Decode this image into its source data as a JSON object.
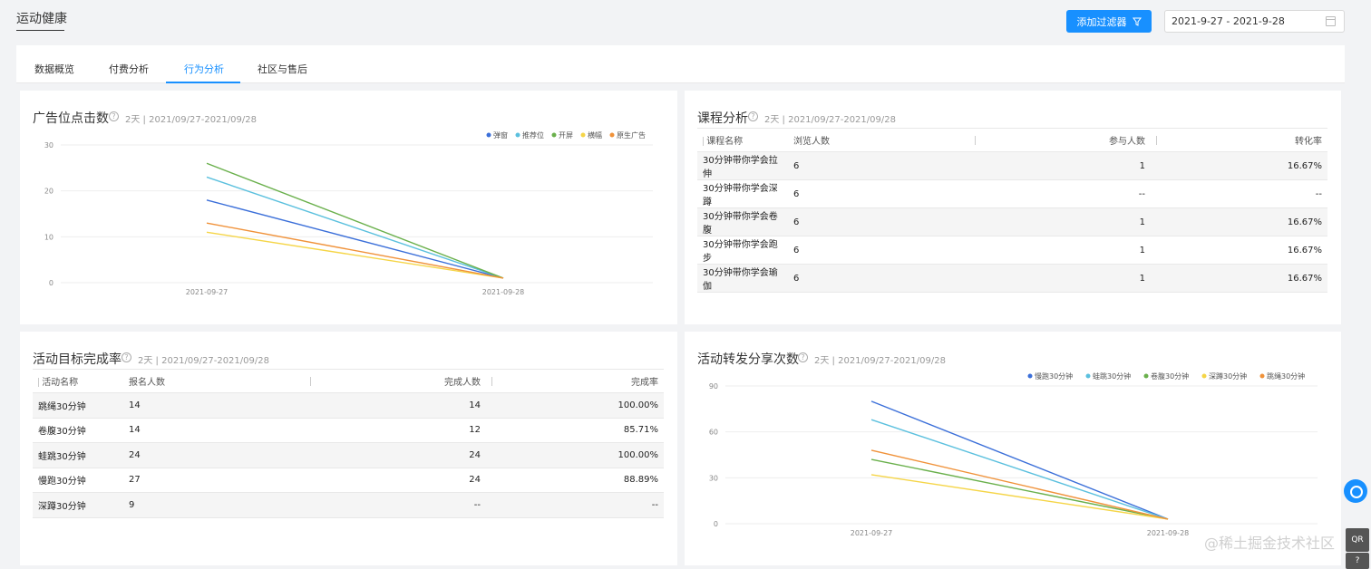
{
  "header": {
    "title": "运动健康",
    "filter_button": "添加过滤器",
    "date_range": "2021-9-27 - 2021-9-28"
  },
  "tabs": [
    "数据概览",
    "付费分析",
    "行为分析",
    "社区与售后"
  ],
  "active_tab": "行为分析",
  "ad_card": {
    "title": "广告位点击数",
    "subtitle": "2天 | 2021/09/27-2021/09/28"
  },
  "course_card": {
    "title": "课程分析",
    "subtitle": "2天 | 2021/09/27-2021/09/28",
    "columns": [
      "课程名称",
      "浏览人数",
      "参与人数",
      "转化率"
    ],
    "rows": [
      [
        "30分钟带你学会拉伸",
        "6",
        "1",
        "16.67%"
      ],
      [
        "30分钟带你学会深蹲",
        "6",
        "--",
        "--"
      ],
      [
        "30分钟带你学会卷腹",
        "6",
        "1",
        "16.67%"
      ],
      [
        "30分钟带你学会跑步",
        "6",
        "1",
        "16.67%"
      ],
      [
        "30分钟带你学会瑜伽",
        "6",
        "1",
        "16.67%"
      ]
    ]
  },
  "activity_card": {
    "title": "活动目标完成率",
    "subtitle": "2天 | 2021/09/27-2021/09/28",
    "columns": [
      "活动名称",
      "报名人数",
      "完成人数",
      "完成率"
    ],
    "rows": [
      [
        "跳绳30分钟",
        "14",
        "14",
        "100.00%"
      ],
      [
        "卷腹30分钟",
        "14",
        "12",
        "85.71%"
      ],
      [
        "蛙跳30分钟",
        "24",
        "24",
        "100.00%"
      ],
      [
        "慢跑30分钟",
        "27",
        "24",
        "88.89%"
      ],
      [
        "深蹲30分钟",
        "9",
        "--",
        "--"
      ]
    ]
  },
  "share_card": {
    "title": "活动转发分享次数",
    "subtitle": "2天 | 2021/09/27-2021/09/28"
  },
  "side": {
    "qr": "QR",
    "help": "?"
  },
  "watermark": "@稀土掘金技术社区",
  "chart_data": [
    {
      "type": "line",
      "title": "广告位点击数",
      "categories": [
        "2021-09-27",
        "2021-09-28"
      ],
      "ylim": [
        0,
        30
      ],
      "yticks": [
        0,
        10,
        20,
        30
      ],
      "grid": true,
      "legend": "top-right",
      "series": [
        {
          "name": "弹窗",
          "color": "#3b6fd9",
          "values": [
            18,
            1
          ]
        },
        {
          "name": "推荐位",
          "color": "#5bc0de",
          "values": [
            23,
            1
          ]
        },
        {
          "name": "开屏",
          "color": "#6ab04c",
          "values": [
            26,
            1
          ]
        },
        {
          "name": "横幅",
          "color": "#f5d547",
          "values": [
            11,
            1
          ]
        },
        {
          "name": "原生广告",
          "color": "#f0923a",
          "values": [
            13,
            1
          ]
        }
      ]
    },
    {
      "type": "line",
      "title": "活动转发分享次数",
      "categories": [
        "2021-09-27",
        "2021-09-28"
      ],
      "ylim": [
        0,
        90
      ],
      "yticks": [
        0,
        30,
        60,
        90
      ],
      "grid": true,
      "legend": "top-right",
      "series": [
        {
          "name": "慢跑30分钟",
          "color": "#3b6fd9",
          "values": [
            80,
            3
          ]
        },
        {
          "name": "蛙跳30分钟",
          "color": "#5bc0de",
          "values": [
            68,
            3
          ]
        },
        {
          "name": "卷腹30分钟",
          "color": "#6ab04c",
          "values": [
            42,
            3
          ]
        },
        {
          "name": "深蹲30分钟",
          "color": "#f5d547",
          "values": [
            32,
            3
          ]
        },
        {
          "name": "跳绳30分钟",
          "color": "#f0923a",
          "values": [
            48,
            3
          ]
        }
      ]
    }
  ]
}
